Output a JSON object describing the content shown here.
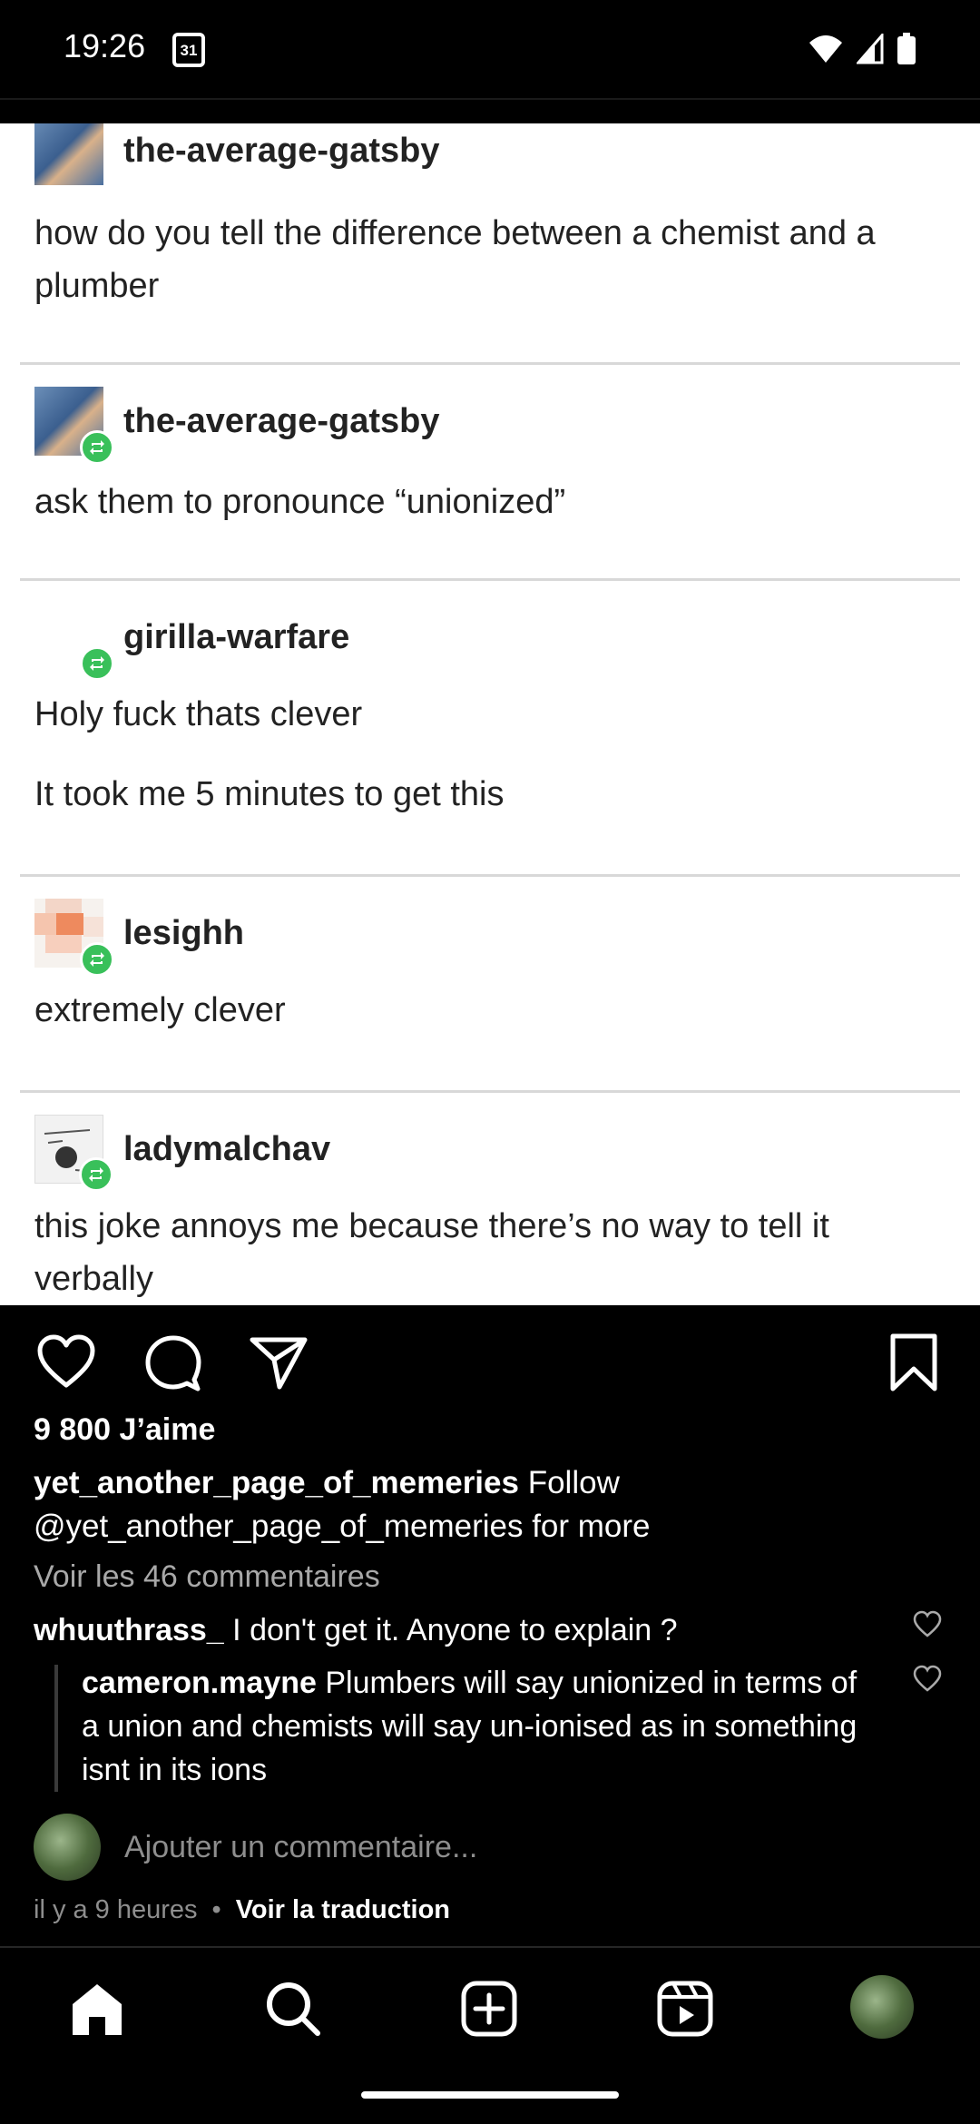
{
  "status_bar": {
    "time": "19:26",
    "calendar_day": "31"
  },
  "post": {
    "blocks": [
      {
        "username": "the-average-gatsby",
        "text": "how do you tell the difference between a chemist and a plumber"
      },
      {
        "username": "the-average-gatsby",
        "text": "ask them to pronounce “unionized”"
      },
      {
        "username": "girilla-warfare",
        "text": "Holy fuck thats clever",
        "text2": "It took me 5 minutes to get this"
      },
      {
        "username": "lesighh",
        "text": "extremely clever"
      },
      {
        "username": "ladymalchav",
        "text": "this joke annoys me because there’s no way to tell it verbally"
      }
    ]
  },
  "likes": "9 800 J’aime",
  "caption": {
    "username": "yet_another_page_of_memeries",
    "text": "Follow @yet_another_page_of_memeries for more"
  },
  "view_comments": "Voir les 46 commentaires",
  "comments": [
    {
      "username": "whuuthrass_",
      "text": "I don't get it. Anyone to explain ?"
    },
    {
      "username": "cameron.mayne",
      "text": "Plumbers will say unionized in terms of a union and chemists will say un-ionised as in something isnt in its ions"
    }
  ],
  "add_comment_placeholder": "Ajouter un commentaire...",
  "meta": {
    "time": "il y a 9 heures",
    "dot": "•",
    "translate": "Voir la traduction"
  },
  "icons": {
    "like": "heart-icon",
    "comment": "comment-icon",
    "share": "send-icon",
    "save": "bookmark-icon",
    "nav": [
      "home-icon",
      "search-icon",
      "create-icon",
      "reels-icon",
      "profile-avatar"
    ]
  }
}
